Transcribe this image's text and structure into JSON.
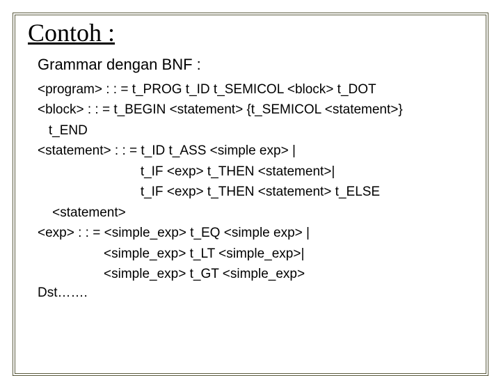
{
  "title": "Contoh :",
  "subtitle": "Grammar dengan BNF :",
  "lines": [
    "<program> : : = t_PROG t_ID t_SEMICOL <block> t_DOT",
    "<block> : : = t_BEGIN <statement> {t_SEMICOL <statement>}",
    "   t_END",
    "<statement> : : = t_ID t_ASS <simple exp> |",
    "                            t_IF <exp> t_THEN <statement>|",
    "                            t_IF <exp> t_THEN <statement> t_ELSE",
    "    <statement>",
    "<exp> : : = <simple_exp> t_EQ <simple exp> |",
    "                  <simple_exp> t_LT <simple_exp>|",
    "                  <simple_exp> t_GT <simple_exp>"
  ],
  "footer": "Dst……."
}
